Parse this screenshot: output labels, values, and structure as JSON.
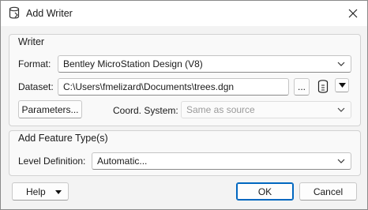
{
  "window": {
    "title": "Add Writer",
    "icon": "fme-writer-icon",
    "close_icon": "close-icon"
  },
  "writer_group": {
    "title": "Writer",
    "format_label": "Format:",
    "format_value": "Bentley MicroStation Design (V8)",
    "dataset_label": "Dataset:",
    "dataset_value": "C:\\Users\\fmelizard\\Documents\\trees.dgn",
    "browse_label": "...",
    "parameters_label": "Parameters...",
    "coord_label": "Coord. System:",
    "coord_value": "Same as source"
  },
  "feature_group": {
    "title": "Add Feature Type(s)",
    "level_label": "Level Definition:",
    "level_value": "Automatic..."
  },
  "footer": {
    "help_label": "Help",
    "ok_label": "OK",
    "cancel_label": "Cancel"
  },
  "colors": {
    "accent": "#0067c0",
    "border": "#c4c4c4",
    "background": "#f3f3f3"
  }
}
